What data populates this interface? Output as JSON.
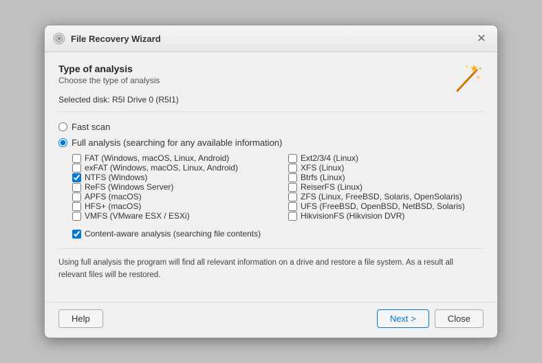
{
  "dialog": {
    "title": "File Recovery Wizard",
    "close_label": "✕"
  },
  "header": {
    "section_title": "Type of analysis",
    "section_subtitle": "Choose the type of analysis",
    "selected_disk": "Selected disk: R5I Drive 0 (R5I1)"
  },
  "analysis": {
    "fast_scan_label": "Fast scan",
    "full_analysis_label": "Full analysis (searching for any available information)"
  },
  "filesystems_left": [
    {
      "label": "FAT (Windows, macOS, Linux, Android)",
      "checked": false
    },
    {
      "label": "exFAT (Windows, macOS, Linux, Android)",
      "checked": false
    },
    {
      "label": "NTFS (Windows)",
      "checked": true
    },
    {
      "label": "ReFS (Windows Server)",
      "checked": false
    },
    {
      "label": "APFS (macOS)",
      "checked": false
    },
    {
      "label": "HFS+ (macOS)",
      "checked": false
    },
    {
      "label": "VMFS (VMware ESX / ESXi)",
      "checked": false
    }
  ],
  "filesystems_right": [
    {
      "label": "Ext2/3/4 (Linux)",
      "checked": false
    },
    {
      "label": "XFS (Linux)",
      "checked": false
    },
    {
      "label": "Btrfs (Linux)",
      "checked": false
    },
    {
      "label": "ReiserFS (Linux)",
      "checked": false
    },
    {
      "label": "ZFS (Linux, FreeBSD, Solaris, OpenSolaris)",
      "checked": false
    },
    {
      "label": "UFS (FreeBSD, OpenBSD, NetBSD, Solaris)",
      "checked": false
    },
    {
      "label": "HikvisionFS (Hikvision DVR)",
      "checked": false
    }
  ],
  "content_aware": {
    "label": "Content-aware analysis (searching file contents)",
    "checked": true
  },
  "info_text": "Using full analysis the program will find all relevant information on a drive and restore a file system. As a result all relevant files will be restored.",
  "footer": {
    "help_label": "Help",
    "next_label": "Next >",
    "close_label": "Close"
  }
}
